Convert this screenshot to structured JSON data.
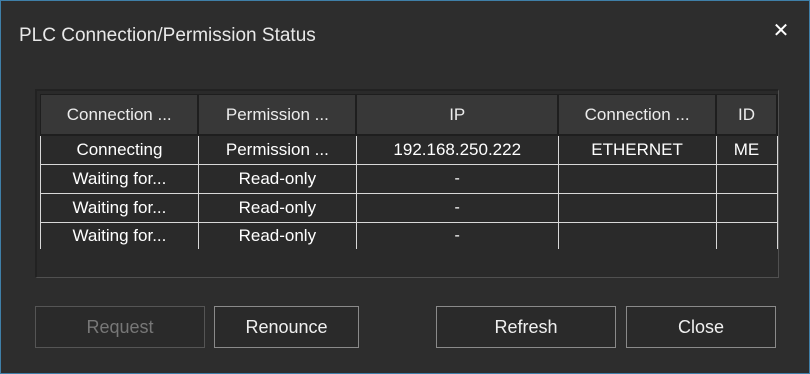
{
  "dialog": {
    "title": "PLC Connection/Permission Status",
    "close_glyph": "✕",
    "close_icon": "close-icon"
  },
  "table": {
    "headers": [
      "Connection ...",
      "Permission ...",
      "IP",
      "Connection ...",
      "ID"
    ],
    "rows": [
      [
        "Connecting",
        "Permission ...",
        "192.168.250.222",
        "ETHERNET",
        "ME"
      ],
      [
        "Waiting for...",
        "Read-only",
        "-",
        "",
        ""
      ],
      [
        "Waiting for...",
        "Read-only",
        "-",
        "",
        ""
      ],
      [
        "Waiting for...",
        "Read-only",
        "-",
        "",
        ""
      ]
    ]
  },
  "buttons": {
    "request": {
      "label": "Request",
      "enabled": false
    },
    "renounce": {
      "label": "Renounce",
      "enabled": true
    },
    "refresh": {
      "label": "Refresh",
      "enabled": true
    },
    "close": {
      "label": "Close",
      "enabled": true
    }
  },
  "colors": {
    "background": "#2d2d2d",
    "border_accent": "#3f7fa8",
    "text": "#ffffff",
    "disabled_text": "#777777"
  }
}
